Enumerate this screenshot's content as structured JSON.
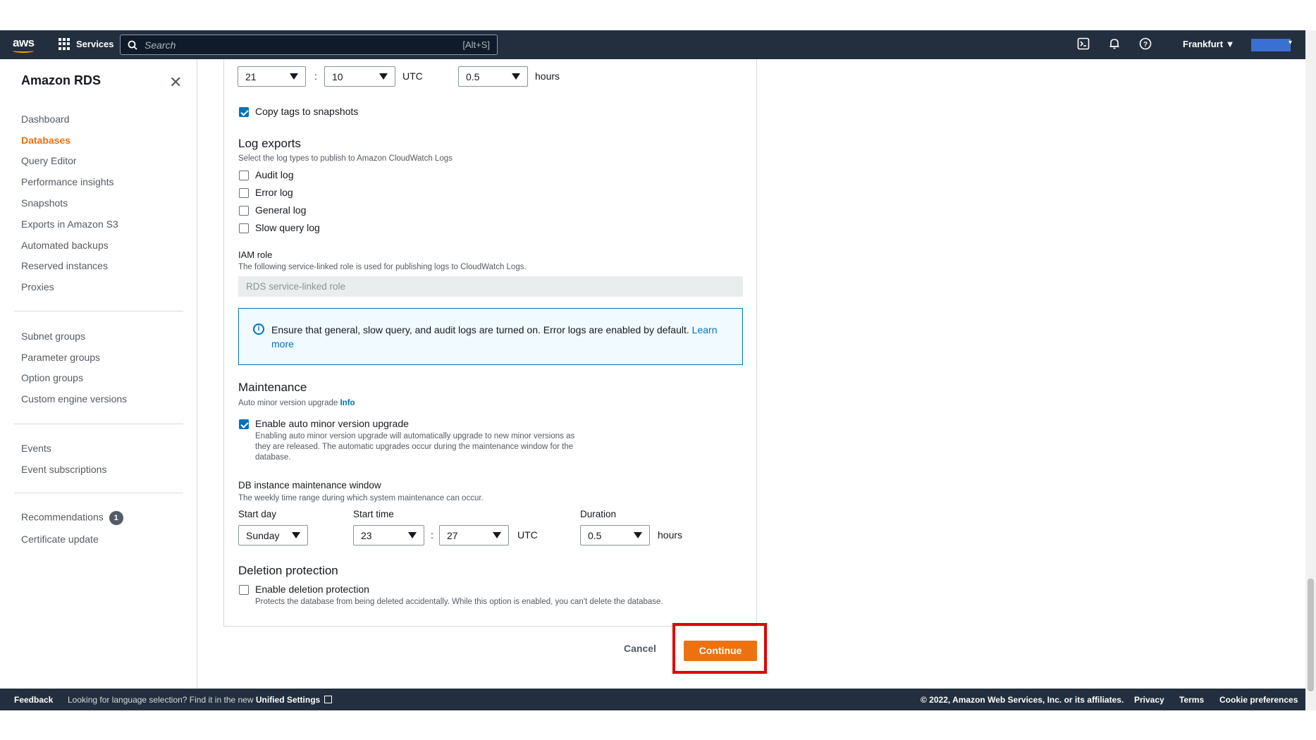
{
  "nav": {
    "logo": "aws",
    "services": "Services",
    "search_placeholder": "Search",
    "search_shortcut": "[Alt+S]",
    "region": "Frankfurt ▼",
    "icons": [
      "terminal-icon",
      "bell-icon",
      "help-icon"
    ]
  },
  "sidebar": {
    "title": "Amazon RDS",
    "items": [
      {
        "label": "Dashboard"
      },
      {
        "label": "Databases"
      },
      {
        "label": "Query Editor"
      },
      {
        "label": "Performance insights"
      },
      {
        "label": "Snapshots"
      },
      {
        "label": "Exports in Amazon S3"
      },
      {
        "label": "Automated backups"
      },
      {
        "label": "Reserved instances"
      },
      {
        "label": "Proxies"
      }
    ],
    "items2": [
      {
        "label": "Subnet groups"
      },
      {
        "label": "Parameter groups"
      },
      {
        "label": "Option groups"
      },
      {
        "label": "Custom engine versions"
      }
    ],
    "items3": [
      {
        "label": "Events"
      },
      {
        "label": "Event subscriptions"
      }
    ],
    "items4": [
      {
        "label": "Recommendations",
        "badge": "1"
      },
      {
        "label": "Certificate update"
      }
    ],
    "active": "Databases"
  },
  "backup_window": {
    "hour": "21",
    "minute": "10",
    "tz": "UTC",
    "duration": "0.5",
    "duration_unit": "hours"
  },
  "copy_tags": {
    "label": "Copy tags to snapshots",
    "checked": true
  },
  "log_exports": {
    "title": "Log exports",
    "description": "Select the log types to publish to Amazon CloudWatch Logs",
    "options": [
      {
        "label": "Audit log",
        "checked": false
      },
      {
        "label": "Error log",
        "checked": false
      },
      {
        "label": "General log",
        "checked": false
      },
      {
        "label": "Slow query log",
        "checked": false
      }
    ]
  },
  "iam_role": {
    "label": "IAM role",
    "description": "The following service-linked role is used for publishing logs to CloudWatch Logs.",
    "value": "RDS service-linked role"
  },
  "info_alert": {
    "text": "Ensure that general, slow query, and audit logs are turned on. Error logs are enabled by default.",
    "link_a": "Learn",
    "link_b": "more"
  },
  "maintenance": {
    "title": "Maintenance",
    "auto_minor_label": "Auto minor version upgrade",
    "info": "Info",
    "enable_label": "Enable auto minor version upgrade",
    "enable_checked": true,
    "enable_desc_1": "Enabling auto minor version upgrade will automatically upgrade to new minor versions as",
    "enable_desc_2": "they are released. The automatic upgrades occur during the maintenance window for the",
    "enable_desc_3": "database.",
    "window_label": "DB instance maintenance window",
    "window_desc": "The weekly time range during which system maintenance can occur.",
    "start_day_label": "Start day",
    "start_day": "Sunday",
    "start_time_label": "Start time",
    "start_hour": "23",
    "start_minute": "27",
    "tz": "UTC",
    "duration_label": "Duration",
    "duration": "0.5",
    "duration_unit": "hours"
  },
  "deletion": {
    "title": "Deletion protection",
    "label": "Enable deletion protection",
    "checked": false,
    "desc": "Protects the database from being deleted accidentally. While this option is enabled, you can't delete the database."
  },
  "actions": {
    "cancel": "Cancel",
    "continue": "Continue"
  },
  "footer": {
    "feedback": "Feedback",
    "lang_text": "Looking for language selection? Find it in the new",
    "unified": "Unified Settings",
    "copyright": "© 2022, Amazon Web Services, Inc. or its affiliates.",
    "privacy": "Privacy",
    "terms": "Terms",
    "cookies": "Cookie preferences"
  }
}
